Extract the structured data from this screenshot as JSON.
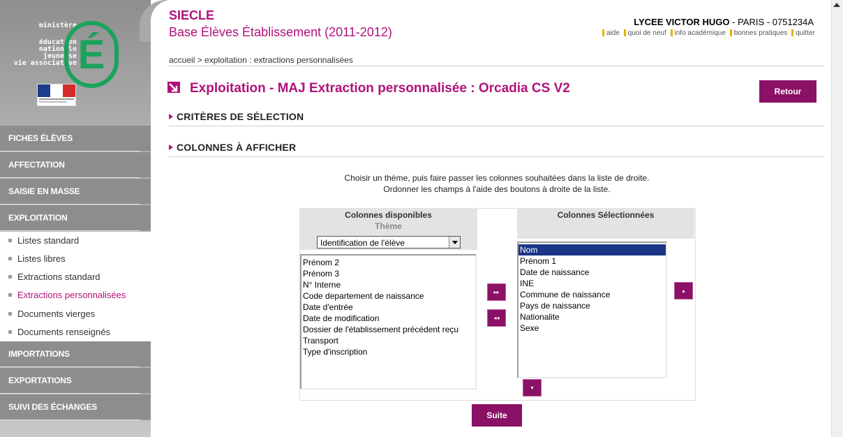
{
  "logo": {
    "ministry_lines": [
      "ministère",
      "éducation",
      "nationale",
      "jeunesse",
      "vie associative"
    ],
    "big_letter": "É"
  },
  "sidebar": {
    "nav_top": [
      {
        "label": "FICHES ÉLÈVES"
      },
      {
        "label": "AFFECTATION"
      },
      {
        "label": "SAISIE EN MASSE"
      },
      {
        "label": "EXPLOITATION"
      }
    ],
    "sub_items": [
      {
        "label": "Listes standard"
      },
      {
        "label": "Listes libres"
      },
      {
        "label": "Extractions standard"
      },
      {
        "label": "Extractions personnalisées"
      },
      {
        "label": "Documents vierges"
      },
      {
        "label": "Documents renseignés"
      }
    ],
    "nav_bottom": [
      {
        "label": "IMPORTATIONS"
      },
      {
        "label": "EXPORTATIONS"
      },
      {
        "label": "SUIVI DES ÉCHANGES"
      }
    ]
  },
  "header": {
    "app_name": "SIECLE",
    "app_subtitle": "Base Élèves Établissement (2011-2012)",
    "school_name": "LYCEE VICTOR HUGO",
    "school_city": "PARIS",
    "school_code": "0751234A",
    "links": [
      "aide",
      "quoi de neuf",
      "info académique",
      "bonnes pratiques",
      "quitter"
    ]
  },
  "breadcrumb": "accueil > exploitation : extractions personnalisées",
  "page": {
    "title": "Exploitation - MAJ Extraction personnalisée : Orcadia CS V2",
    "retour_label": "Retour",
    "section_criteria": "CRITÈRES DE SÉLECTION",
    "section_columns": "COLONNES À AFFICHER",
    "instruction_line1": "Choisir un thème, puis faire passer les colonnes souhaitées dans la liste de droite.",
    "instruction_line2": "Ordonner les champs à l'aide des boutons à droite de la liste.",
    "suite_label": "Suite"
  },
  "selector": {
    "available_title": "Colonnes disponibles",
    "theme_label": "Thème",
    "theme_value": "Identification de l'élève",
    "selected_title": "Colonnes Sélectionnées",
    "available": [
      "Prénom 2",
      "Prénom 3",
      "N° Interne",
      "Code departement de naissance",
      "Date d'entrée",
      "Date de modification",
      "Dossier de l'établissement précédent reçu",
      "Transport",
      "Type d'inscription"
    ],
    "selected": [
      "Nom",
      "Prénom 1",
      "Date de naissance",
      "INE",
      "Commune de naissance",
      "Pays de naissance",
      "Nationalite",
      "Sexe"
    ],
    "selected_highlight": "Nom",
    "btn_add": "▸▸",
    "btn_remove": "◂◂",
    "btn_up": "▴",
    "btn_down": "▾"
  }
}
